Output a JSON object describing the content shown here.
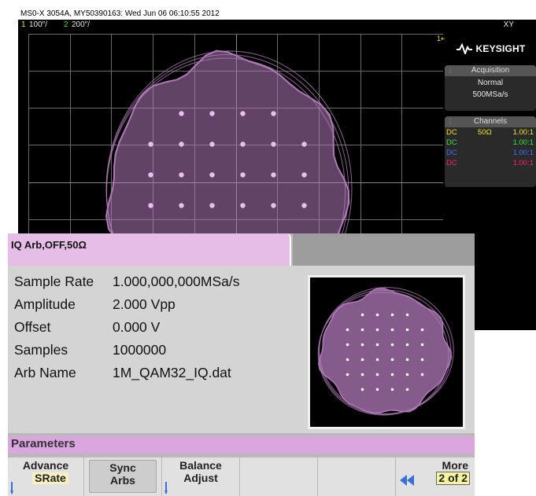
{
  "scope": {
    "title": "MS0-X 3054A, MY50390163: Wed Jun 06 06:10:55 2012",
    "ch1_num": "1",
    "ch1_scale": "100″/",
    "ch2_num": "2",
    "ch2_scale": "200″/",
    "mode": "XY",
    "brand": "KEYSIGHT",
    "acquisition": {
      "header": "Acquisition",
      "mode": "Normal",
      "rate": "500MSa/s"
    },
    "channels": {
      "header": "Channels",
      "rows": [
        {
          "coupling": "DC",
          "imp": "50Ω",
          "probe": "1.00:1",
          "color": "#f0e020"
        },
        {
          "coupling": "DC",
          "imp": "",
          "probe": "1.00:1",
          "color": "#40e040"
        },
        {
          "coupling": "DC",
          "imp": "",
          "probe": "1.00:1",
          "color": "#4070ff"
        },
        {
          "coupling": "DC",
          "imp": "",
          "probe": "1.00:1",
          "color": "#ff2060"
        }
      ]
    }
  },
  "generator": {
    "tab_label": "IQ Arb,OFF,50Ω",
    "params": [
      {
        "label": "Sample Rate",
        "value": "1.000,000,000MSa/s"
      },
      {
        "label": "Amplitude",
        "value": "2.000 Vpp"
      },
      {
        "label": "Offset",
        "value": "0.000 V"
      },
      {
        "label": "Samples",
        "value": "1000000"
      },
      {
        "label": "Arb Name",
        "value": "1M_QAM32_IQ.dat"
      }
    ],
    "section_title": "Parameters",
    "softkeys": {
      "advance_l1": "Advance",
      "advance_l2": "SRate",
      "sync_l1": "Sync",
      "sync_l2": "Arbs",
      "balance_l1": "Balance",
      "balance_l2": "Adjust",
      "more_l1": "More",
      "more_l2": "2 of 2"
    }
  },
  "colors": {
    "constellation": "#b07ab8",
    "tab": "#e6bde6",
    "params_bar": "#dba6df"
  }
}
